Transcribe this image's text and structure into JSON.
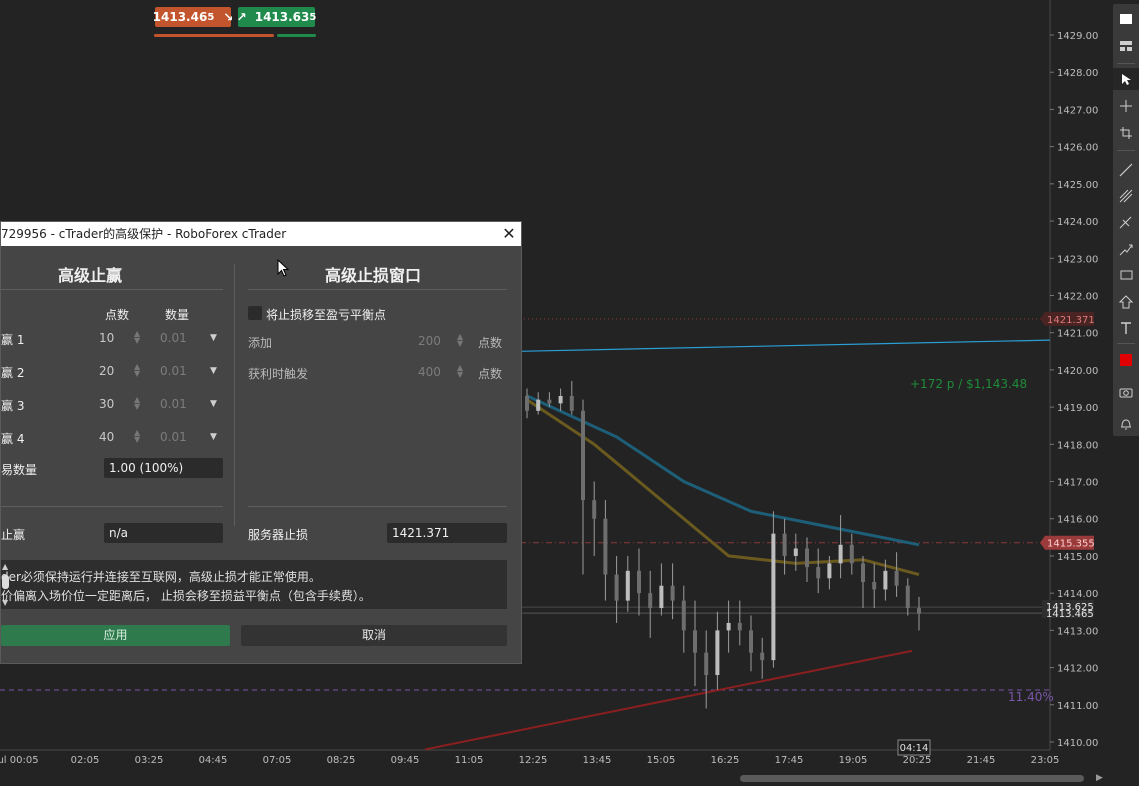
{
  "trade": {
    "sell_price": "1413.46",
    "sell_price_small": "5",
    "buy_price": "1413.63",
    "buy_price_small": "5",
    "sell_icon": "arrow-down-right-icon",
    "buy_icon": "arrow-up-right-icon"
  },
  "price_axis": {
    "ticks": [
      "1429.00",
      "1428.00",
      "1427.00",
      "1426.00",
      "1425.00",
      "1424.00",
      "1423.00",
      "1422.00",
      "1421.00",
      "1420.00",
      "1419.00",
      "1418.00",
      "1417.00",
      "1416.00",
      "1415.00",
      "1414.00",
      "1413.00",
      "1412.00",
      "1411.00",
      "1410.00"
    ],
    "tp_level": "1421.371",
    "sl_level": "1415.355",
    "bid_label": "1413.465",
    "ask_label": "1413.625"
  },
  "time_axis": {
    "ticks": [
      "ul 00:05",
      "02:05",
      "03:25",
      "04:45",
      "07:05",
      "08:25",
      "09:45",
      "11:05",
      "12:25",
      "13:45",
      "15:05",
      "16:25",
      "17:45",
      "19:05",
      "20:25",
      "21:45",
      "23:05"
    ],
    "cursor_time": "04:14"
  },
  "overlays": {
    "profit_text": "+172 p /  $1,143.48",
    "percent_text": "11.40%"
  },
  "dialog": {
    "title": "729956 - cTrader的高级保护 - RoboForex cTrader",
    "left_section_title": "高级止赢",
    "right_section_title": "高级止损窗口",
    "col_points": "点数",
    "col_qty": "数量",
    "tp_rows": [
      {
        "label": "赢 1",
        "points": "10",
        "qty": "0.01"
      },
      {
        "label": "赢 2",
        "points": "20",
        "qty": "0.01"
      },
      {
        "label": "赢 3",
        "points": "30",
        "qty": "0.01"
      },
      {
        "label": "赢 4",
        "points": "40",
        "qty": "0.01"
      }
    ],
    "trade_qty_label": "易数量",
    "trade_qty_value": "1.00 (100%)",
    "breakeven_label": "将止损移至盈亏平衡点",
    "add_label": "添加",
    "add_value": "200",
    "add_unit": "点数",
    "trigger_label": "获利时触发",
    "trigger_value": "400",
    "trigger_unit": "点数",
    "stop_tp_label": "止赢",
    "stop_tp_value": "n/a",
    "server_sl_label": "服务器止损",
    "server_sl_value": "1421.371",
    "info_line1": "der必须保持运行并连接至互联网，高级止损才能正常使用。",
    "info_line2": "价偏离入场价位一定距离后， 止损会移至损益平衡点（包含手续费）。",
    "apply_label": "应用",
    "cancel_label": "取消"
  },
  "chart_data": {
    "type": "candlestick",
    "instrument_price_range": [
      1410,
      1429.5
    ],
    "levels": {
      "take_profit": 1421.371,
      "stop_loss": 1415.355,
      "bid": 1413.465,
      "ask": 1413.625
    },
    "candles": [
      [
        1419.3,
        1419.5,
        1418.7,
        1418.9
      ],
      [
        1418.9,
        1419.4,
        1418.8,
        1419.2
      ],
      [
        1419.2,
        1419.4,
        1419.0,
        1419.1
      ],
      [
        1419.1,
        1419.5,
        1418.9,
        1419.3
      ],
      [
        1419.3,
        1419.7,
        1418.8,
        1418.9
      ],
      [
        1418.9,
        1419.2,
        1414.5,
        1416.5
      ],
      [
        1416.5,
        1417.0,
        1415.0,
        1416.0
      ],
      [
        1416.0,
        1416.5,
        1413.8,
        1414.5
      ],
      [
        1414.5,
        1415.0,
        1413.2,
        1413.8
      ],
      [
        1413.8,
        1415.0,
        1413.5,
        1414.6
      ],
      [
        1414.6,
        1415.2,
        1413.4,
        1414.0
      ],
      [
        1414.0,
        1414.6,
        1412.8,
        1413.6
      ],
      [
        1413.6,
        1414.8,
        1413.4,
        1414.2
      ],
      [
        1414.2,
        1414.8,
        1413.3,
        1413.8
      ],
      [
        1413.8,
        1414.2,
        1412.4,
        1413.0
      ],
      [
        1413.0,
        1413.8,
        1411.5,
        1412.4
      ],
      [
        1412.4,
        1413.0,
        1410.9,
        1411.8
      ],
      [
        1411.8,
        1413.5,
        1411.4,
        1413.0
      ],
      [
        1413.0,
        1413.8,
        1412.4,
        1413.2
      ],
      [
        1413.2,
        1413.8,
        1412.6,
        1413.0
      ],
      [
        1413.0,
        1413.4,
        1411.9,
        1412.4
      ],
      [
        1412.4,
        1412.8,
        1411.7,
        1412.2
      ],
      [
        1412.2,
        1416.2,
        1412.0,
        1415.6
      ],
      [
        1415.6,
        1416.0,
        1414.5,
        1415.0
      ],
      [
        1415.0,
        1415.6,
        1414.6,
        1415.2
      ],
      [
        1415.2,
        1415.5,
        1414.3,
        1414.7
      ],
      [
        1414.7,
        1415.2,
        1414.0,
        1414.4
      ],
      [
        1414.4,
        1415.0,
        1414.1,
        1414.8
      ],
      [
        1414.8,
        1416.1,
        1414.4,
        1415.3
      ],
      [
        1415.3,
        1415.6,
        1414.5,
        1414.8
      ],
      [
        1414.8,
        1415.0,
        1413.6,
        1414.3
      ],
      [
        1414.3,
        1414.8,
        1413.6,
        1414.1
      ],
      [
        1414.1,
        1414.9,
        1413.8,
        1414.6
      ],
      [
        1414.6,
        1415.1,
        1413.9,
        1414.2
      ],
      [
        1414.2,
        1414.4,
        1413.4,
        1413.6
      ],
      [
        1413.6,
        1413.9,
        1413.0,
        1413.45
      ]
    ],
    "moving_averages": [
      {
        "color": "#1d5e78",
        "points": [
          [
            0,
            1419.3
          ],
          [
            8,
            1418.2
          ],
          [
            14,
            1417.0
          ],
          [
            20,
            1416.2
          ],
          [
            25,
            1415.9
          ],
          [
            30,
            1415.6
          ],
          [
            35,
            1415.3
          ]
        ]
      },
      {
        "color": "#6b5a1e",
        "points": [
          [
            0,
            1419.2
          ],
          [
            6,
            1418.0
          ],
          [
            12,
            1416.5
          ],
          [
            18,
            1415.0
          ],
          [
            24,
            1414.8
          ],
          [
            30,
            1414.9
          ],
          [
            35,
            1414.5
          ]
        ]
      }
    ],
    "trendlines": [
      {
        "color": "#2a9fd6",
        "from": [
          1420.5,
          520
        ],
        "to": [
          1420.8,
          1050
        ]
      },
      {
        "color": "#8b1f1f",
        "from": [
          1409.8,
          425
        ],
        "to": [
          1412.45,
          912
        ]
      }
    ],
    "colors": {
      "tp_line": "#8a3a3a",
      "sl_line": "#8a3a3a",
      "percent_line": "#7a56a8",
      "profit_text": "#1e8c38"
    }
  },
  "toolbar_icons": [
    "chart-type-icon",
    "layout-icon",
    "cursor-icon",
    "crosshair-icon",
    "measure-icon",
    "line-icon",
    "fibonacci-icon",
    "pitchfork-icon",
    "arrow-tool-icon",
    "rectangle-icon",
    "shape-icon",
    "text-icon",
    "color-swatch-icon",
    "camera-icon",
    "alert-icon"
  ]
}
